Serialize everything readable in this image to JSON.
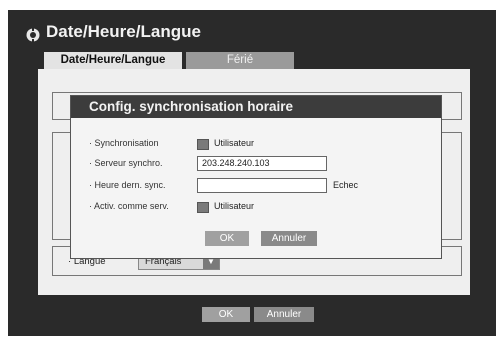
{
  "window": {
    "title": "Date/Heure/Langue"
  },
  "tabs": [
    {
      "label": "Date/Heure/Langue",
      "active": true
    },
    {
      "label": "Férié",
      "active": false
    }
  ],
  "language": {
    "label": "Langue",
    "value": "Français"
  },
  "footer": {
    "ok_label": "OK",
    "cancel_label": "Annuler"
  },
  "dialog": {
    "title": "Config. synchronisation horaire",
    "sync": {
      "label": "Synchronisation",
      "checkbox_label": "Utilisateur"
    },
    "server": {
      "label": "Serveur synchro.",
      "value": "203.248.240.103"
    },
    "last_sync": {
      "label": "Heure dern. sync.",
      "value": "",
      "status": "Echec"
    },
    "activate": {
      "label": "Activ. comme serv.",
      "checkbox_label": "Utilisateur"
    },
    "ok_label": "OK",
    "cancel_label": "Annuler"
  },
  "colors": {
    "frame": "#2a2a2a",
    "tab_active": "#e3e3e3",
    "tab_inactive": "#9a9a9a",
    "dialog_header": "#3c3c3c"
  }
}
